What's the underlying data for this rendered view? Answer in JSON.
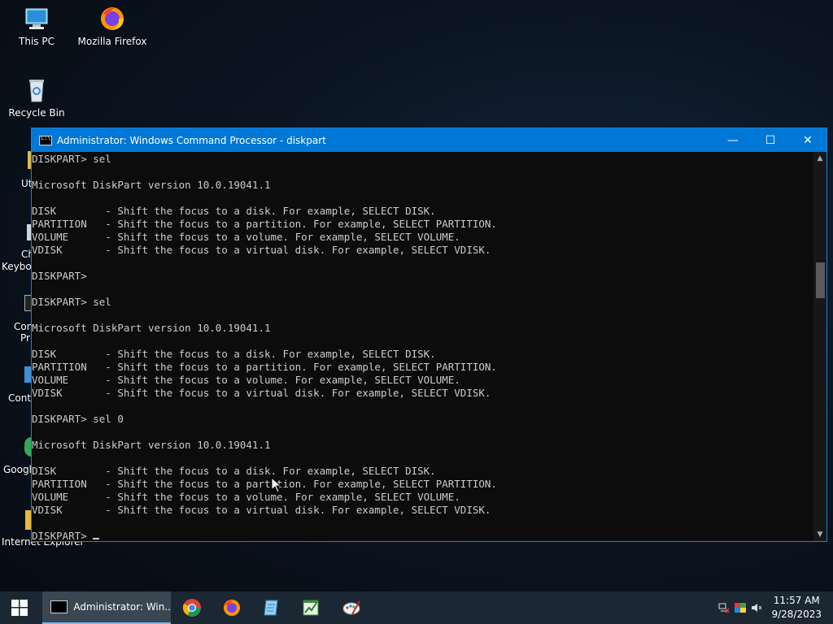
{
  "desktop": {
    "icons": [
      {
        "label": "This PC",
        "icon": "this-pc-icon"
      },
      {
        "label": "Mozilla Firefox",
        "icon": "firefox-icon"
      },
      {
        "label": "Recycle Bin",
        "icon": "recycle-bin-icon"
      }
    ],
    "partial_labels": [
      "Ut",
      "Ch",
      "Keyboa",
      "Con",
      "Pr",
      "Contr",
      "Googl",
      "Internet Explorer"
    ]
  },
  "window": {
    "title": "Administrator: Windows Command Processor - diskpart",
    "minimize": "—",
    "maximize": "☐",
    "close": "✕"
  },
  "console": {
    "lines": [
      "DISKPART> sel",
      "",
      "Microsoft DiskPart version 10.0.19041.1",
      "",
      "DISK        - Shift the focus to a disk. For example, SELECT DISK.",
      "PARTITION   - Shift the focus to a partition. For example, SELECT PARTITION.",
      "VOLUME      - Shift the focus to a volume. For example, SELECT VOLUME.",
      "VDISK       - Shift the focus to a virtual disk. For example, SELECT VDISK.",
      "",
      "DISKPART>",
      "",
      "DISKPART> sel",
      "",
      "Microsoft DiskPart version 10.0.19041.1",
      "",
      "DISK        - Shift the focus to a disk. For example, SELECT DISK.",
      "PARTITION   - Shift the focus to a partition. For example, SELECT PARTITION.",
      "VOLUME      - Shift the focus to a volume. For example, SELECT VOLUME.",
      "VDISK       - Shift the focus to a virtual disk. For example, SELECT VDISK.",
      "",
      "DISKPART> sel 0",
      "",
      "Microsoft DiskPart version 10.0.19041.1",
      "",
      "DISK        - Shift the focus to a disk. For example, SELECT DISK.",
      "PARTITION   - Shift the focus to a partition. For example, SELECT PARTITION.",
      "VOLUME      - Shift the focus to a volume. For example, SELECT VOLUME.",
      "VDISK       - Shift the focus to a virtual disk. For example, SELECT VDISK.",
      ""
    ],
    "prompt": "DISKPART> "
  },
  "taskbar": {
    "active_task": "Administrator: Win...",
    "pinned": [
      "chrome-icon",
      "firefox-icon",
      "notepad-icon",
      "spreadsheet-icon",
      "paint-icon"
    ],
    "tray_icons": [
      "network-icon",
      "color-icon",
      "volume-icon"
    ],
    "time": "11:57 AM",
    "date": "9/28/2023"
  },
  "colors": {
    "titlebar": "#0078d7",
    "console_bg": "#0c0c0c",
    "console_text": "#cccccc",
    "taskbar": "#1b2733"
  }
}
